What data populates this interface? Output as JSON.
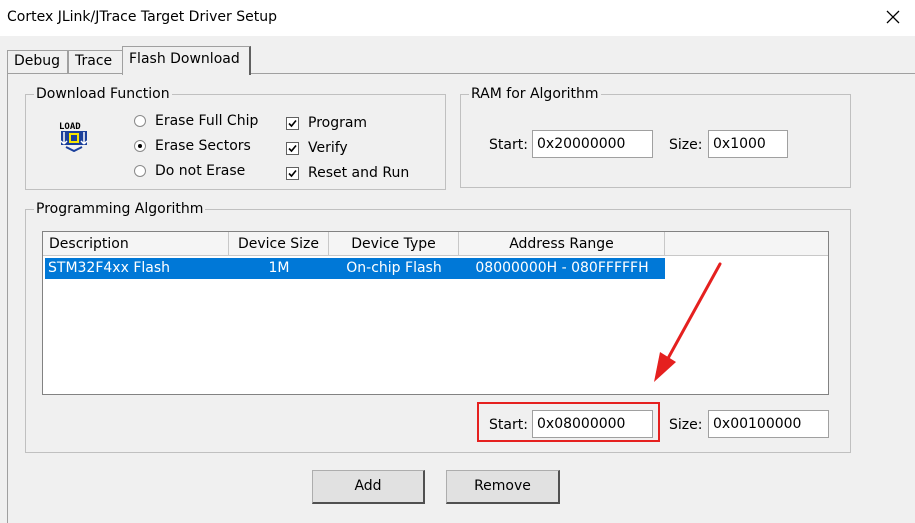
{
  "window": {
    "title": "Cortex JLink/JTrace Target Driver Setup"
  },
  "tabs": [
    {
      "label": "Debug"
    },
    {
      "label": "Trace"
    },
    {
      "label": "Flash Download"
    }
  ],
  "download_function": {
    "legend": "Download Function",
    "icon_text": "LOAD",
    "radios": [
      {
        "label": "Erase Full Chip",
        "selected": false
      },
      {
        "label": "Erase Sectors",
        "selected": true
      },
      {
        "label": "Do not Erase",
        "selected": false
      }
    ],
    "checks": [
      {
        "label": "Program",
        "checked": true
      },
      {
        "label": "Verify",
        "checked": true
      },
      {
        "label": "Reset and Run",
        "checked": true
      }
    ]
  },
  "ram": {
    "legend": "RAM for Algorithm",
    "start_label": "Start:",
    "start_value": "0x20000000",
    "size_label": "Size:",
    "size_value": "0x1000"
  },
  "algorithm": {
    "legend": "Programming Algorithm",
    "columns": [
      "Description",
      "Device Size",
      "Device Type",
      "Address Range"
    ],
    "rows": [
      {
        "description": "STM32F4xx Flash",
        "device_size": "1M",
        "device_type": "On-chip Flash",
        "address_range": "08000000H - 080FFFFFH"
      }
    ],
    "start_label": "Start:",
    "start_value": "0x08000000",
    "size_label": "Size:",
    "size_value": "0x00100000"
  },
  "buttons": {
    "add": "Add",
    "remove": "Remove"
  },
  "colors": {
    "selection": "#0078d7",
    "highlight": "#e5201f"
  }
}
